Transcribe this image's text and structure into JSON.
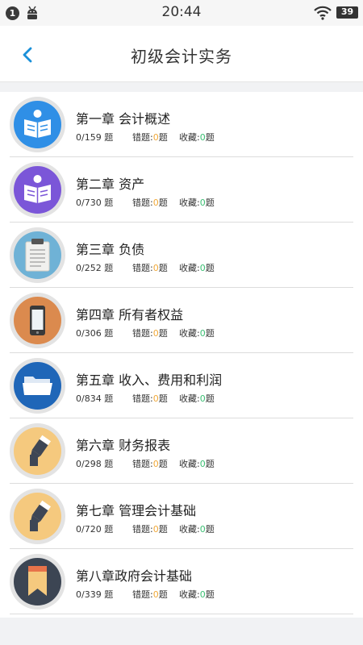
{
  "status_bar": {
    "notification_count": "1",
    "time": "20:44",
    "battery": "39"
  },
  "header": {
    "title": "初级会计实务"
  },
  "labels": {
    "unit": "题",
    "wrong": "错题:",
    "favorites": "收藏:"
  },
  "colors": {
    "wrong_value": "#f0a93a",
    "favorite_value": "#3bbf73",
    "back_arrow": "#1a90d9"
  },
  "chapters": [
    {
      "title": "第一章 会计概述",
      "progress": "0/159",
      "wrong": "0",
      "favorites": "0",
      "icon": "reading-icon",
      "icon_color": "#2f8fe6"
    },
    {
      "title": "第二章 资产",
      "progress": "0/730",
      "wrong": "0",
      "favorites": "0",
      "icon": "reading-icon",
      "icon_color": "#7b56d8"
    },
    {
      "title": "第三章 负债",
      "progress": "0/252",
      "wrong": "0",
      "favorites": "0",
      "icon": "clipboard-icon",
      "icon_color": "#6fb2d6"
    },
    {
      "title": "第四章 所有者权益",
      "progress": "0/306",
      "wrong": "0",
      "favorites": "0",
      "icon": "phone-icon",
      "icon_color": "#db8a4e"
    },
    {
      "title": "第五章 收入、费用和利润",
      "progress": "0/834",
      "wrong": "0",
      "favorites": "0",
      "icon": "folder-icon",
      "icon_color": "#1f66b8"
    },
    {
      "title": "第六章 财务报表",
      "progress": "0/298",
      "wrong": "0",
      "favorites": "0",
      "icon": "pen-icon",
      "icon_color": "#f5c97e"
    },
    {
      "title": "第七章 管理会计基础",
      "progress": "0/720",
      "wrong": "0",
      "favorites": "0",
      "icon": "pen-icon",
      "icon_color": "#f5c97e"
    },
    {
      "title": "第八章政府会计基础",
      "progress": "0/339",
      "wrong": "0",
      "favorites": "0",
      "icon": "bookmark-icon",
      "icon_color": "#3c4553"
    }
  ]
}
